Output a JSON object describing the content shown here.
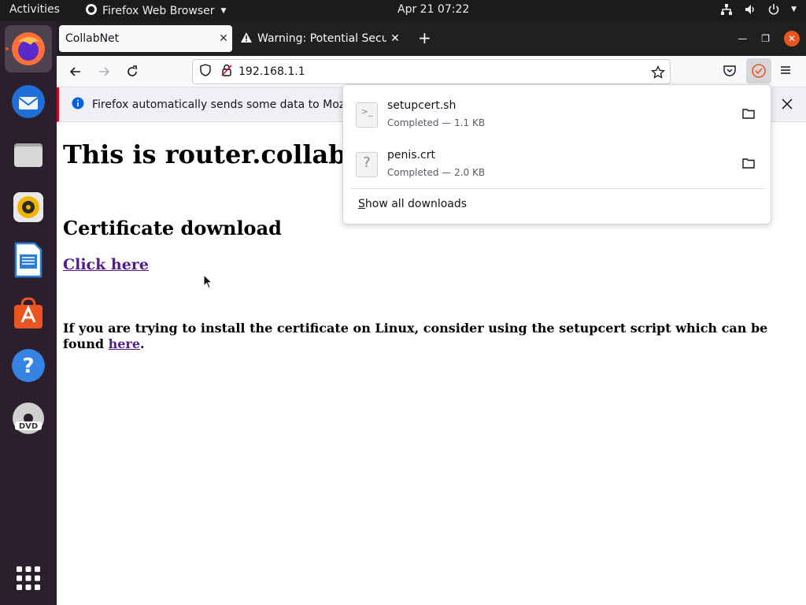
{
  "topbar": {
    "activities": "Activities",
    "app_name": "Firefox Web Browser",
    "clock": "Apr 21  07:22"
  },
  "dock": {
    "items": [
      "firefox",
      "thunderbird",
      "files",
      "rhythmbox",
      "libreoffice-writer",
      "software-center",
      "help",
      "dvd",
      "show-applications"
    ]
  },
  "browser": {
    "tabs": [
      {
        "title": "CollabNet",
        "active": true
      },
      {
        "title": "Warning: Potential Securi",
        "active": false
      }
    ],
    "url": "192.168.1.1",
    "notification": "Firefox automatically sends some data to Mozilla"
  },
  "page": {
    "heading": "This is router.collab",
    "subheading": "Certificate download",
    "link": "Click here",
    "note": "If you are trying to install the certificate on Linux, consider using the setupcert script which can be found ",
    "note_link": "here",
    "note_end": "."
  },
  "downloads": {
    "items": [
      {
        "name": "setupcert.sh",
        "status": "Completed — 1.1 KB",
        "icon": ">_"
      },
      {
        "name": "penis.crt",
        "status": "Completed — 2.0 KB",
        "icon": "?"
      }
    ],
    "show_all_prefix": "S",
    "show_all_rest": "how all downloads"
  },
  "colors": {
    "ubuntu_orange": "#e95420",
    "dock_bg": "#2b1f2e",
    "link_visited": "#551a8b"
  }
}
